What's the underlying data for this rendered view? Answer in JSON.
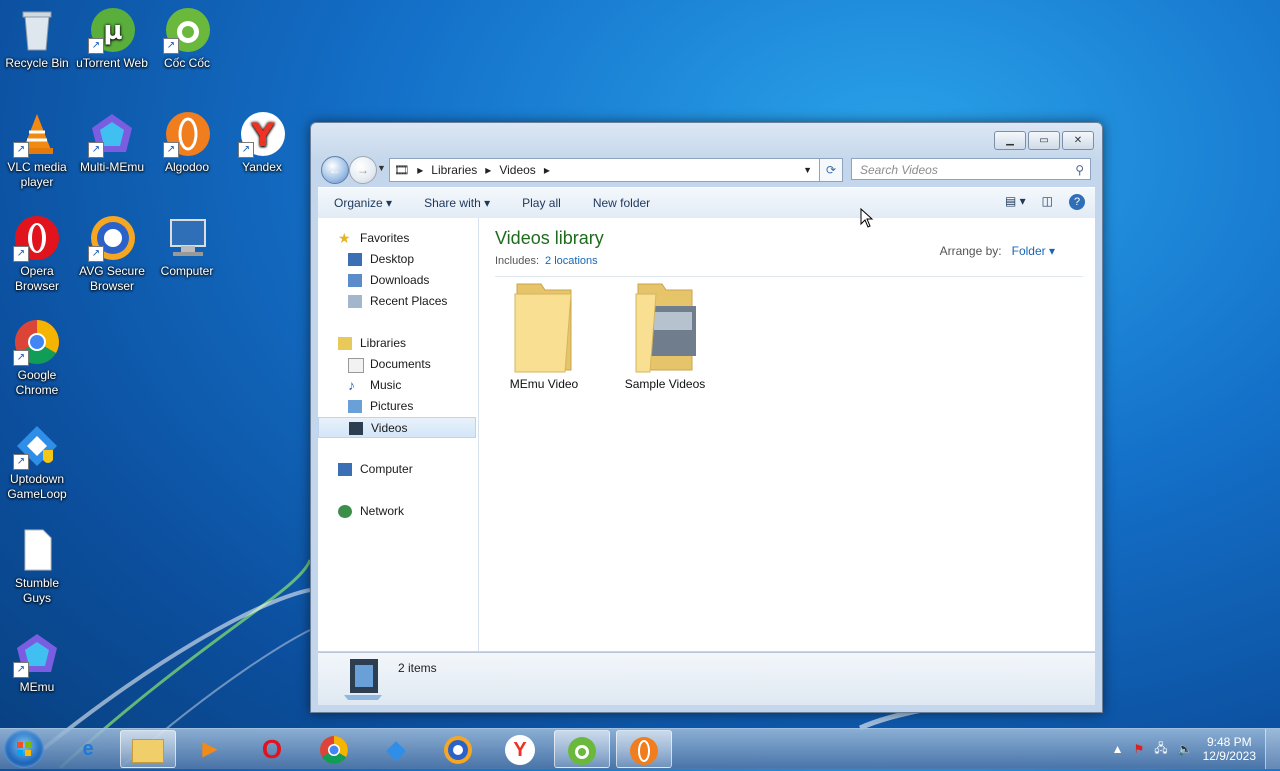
{
  "desktop": {
    "icons": [
      {
        "label": "Recycle Bin",
        "icon": "recycle-bin-icon"
      },
      {
        "label": "uTorrent Web",
        "icon": "utorrent-icon"
      },
      {
        "label": "Cốc Cốc",
        "icon": "coccoc-icon"
      },
      {
        "label": "VLC media player",
        "icon": "vlc-icon"
      },
      {
        "label": "Multi-MEmu",
        "icon": "multi-memu-icon"
      },
      {
        "label": "Algodoo",
        "icon": "algodoo-icon"
      },
      {
        "label": "Yandex",
        "icon": "yandex-icon"
      },
      {
        "label": "Opera Browser",
        "icon": "opera-icon"
      },
      {
        "label": "AVG Secure Browser",
        "icon": "avg-icon"
      },
      {
        "label": "Computer",
        "icon": "computer-icon"
      },
      {
        "label": "Google Chrome",
        "icon": "chrome-icon"
      },
      {
        "label": "Uptodown GameLoop",
        "icon": "gameloop-icon"
      },
      {
        "label": "Stumble Guys",
        "icon": "file-icon"
      },
      {
        "label": "MEmu",
        "icon": "memu-icon"
      }
    ]
  },
  "window": {
    "breadcrumb": [
      "Libraries",
      "Videos"
    ],
    "search_placeholder": "Search Videos",
    "toolbar": {
      "organize": "Organize",
      "share_with": "Share with",
      "play_all": "Play all",
      "new_folder": "New folder"
    },
    "nav": {
      "favorites": "Favorites",
      "desktop": "Desktop",
      "downloads": "Downloads",
      "recent_places": "Recent Places",
      "libraries": "Libraries",
      "documents": "Documents",
      "music": "Music",
      "pictures": "Pictures",
      "videos": "Videos",
      "computer": "Computer",
      "network": "Network"
    },
    "library": {
      "title": "Videos library",
      "includes_label": "Includes:",
      "includes_link": "2 locations",
      "arrange_label": "Arrange by:",
      "arrange_value": "Folder"
    },
    "folders": [
      {
        "name": "MEmu Video"
      },
      {
        "name": "Sample Videos"
      }
    ],
    "status": {
      "count": "2 items"
    }
  },
  "taskbar": {
    "time": "9:48 PM",
    "date": "12/9/2023"
  },
  "colors": {
    "accent": "#1e6b1e",
    "link": "#1a66b3"
  }
}
